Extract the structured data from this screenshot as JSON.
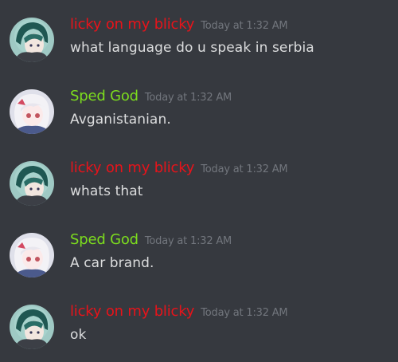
{
  "colors": {
    "background": "#36393f",
    "user_red": "#e8131a",
    "user_green": "#7cdc1e",
    "timestamp": "#72767d",
    "message_text": "#dcddde"
  },
  "messages": [
    {
      "author": "licky on my blicky",
      "author_color": "#e8131a",
      "avatar": "teal-haired-avatar-icon",
      "timestamp": "Today at 1:32 AM",
      "text": "what language do u speak in serbia"
    },
    {
      "author": "Sped God",
      "author_color": "#7cdc1e",
      "avatar": "white-haired-avatar-icon",
      "timestamp": "Today at 1:32 AM",
      "text": "Avganistanian."
    },
    {
      "author": "licky on my blicky",
      "author_color": "#e8131a",
      "avatar": "teal-haired-avatar-icon",
      "timestamp": "Today at 1:32 AM",
      "text": "whats that"
    },
    {
      "author": "Sped God",
      "author_color": "#7cdc1e",
      "avatar": "white-haired-avatar-icon",
      "timestamp": "Today at 1:32 AM",
      "text": "A car brand."
    },
    {
      "author": "licky on my blicky",
      "author_color": "#e8131a",
      "avatar": "teal-haired-avatar-icon",
      "timestamp": "Today at 1:32 AM",
      "text": "ok"
    }
  ]
}
